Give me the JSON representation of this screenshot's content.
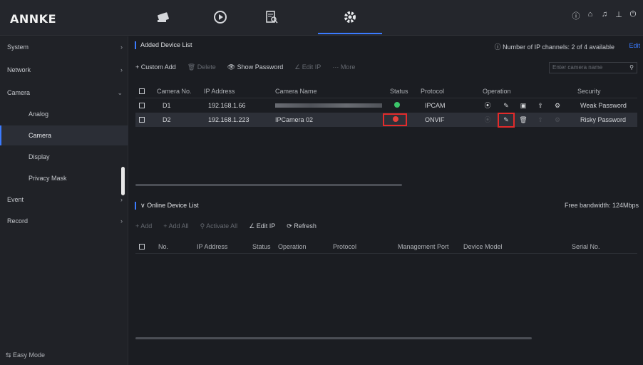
{
  "header": {
    "logo": "ANNKE",
    "nav": [
      "live-view",
      "playback",
      "search",
      "settings"
    ],
    "right_icons": [
      "info-icon",
      "home-icon",
      "alarm-icon",
      "tools-icon",
      "power-icon"
    ]
  },
  "sidebar": {
    "items": [
      {
        "label": "System",
        "chev": "›"
      },
      {
        "label": "Network",
        "chev": "›"
      },
      {
        "label": "Camera",
        "chev": "⌄"
      },
      {
        "label": "Analog"
      },
      {
        "label": "Camera"
      },
      {
        "label": "Display"
      },
      {
        "label": "Privacy Mask"
      },
      {
        "label": "Event",
        "chev": "›"
      },
      {
        "label": "Record",
        "chev": "›"
      }
    ],
    "easy_mode": "⇆ Easy Mode"
  },
  "added": {
    "title": "Added Device List",
    "channels": "ⓘ Number of IP channels: 2 of 4 available",
    "edit": "Edit",
    "toolbar": [
      "+ Custom Add",
      "🗑 Delete",
      "👁 Show Password",
      "∠ Edit IP",
      "⋯ More"
    ],
    "search_placeholder": "Enter camera name",
    "headers": [
      "Camera No.",
      "IP Address",
      "Camera Name",
      "Status",
      "Protocol",
      "Operation",
      "Security"
    ],
    "rows": [
      {
        "no": "D1",
        "ip": "192.168.1.66",
        "name": "",
        "protocol": "IPCAM",
        "security": "Weak Password"
      },
      {
        "no": "D2",
        "ip": "192.168.1.223",
        "name": "IPCamera 02",
        "protocol": "ONVIF",
        "security": "Risky Password"
      }
    ]
  },
  "online": {
    "title": "∨ Online Device List",
    "bandwidth": "Free bandwidth: 124Mbps",
    "toolbar": [
      "+ Add",
      "+ Add All",
      "⚲ Activate All",
      "∠ Edit IP",
      "⟳ Refresh"
    ],
    "headers": [
      "No.",
      "IP Address",
      "Status",
      "Operation",
      "Protocol",
      "Management Port",
      "Device Model",
      "Serial No."
    ]
  }
}
